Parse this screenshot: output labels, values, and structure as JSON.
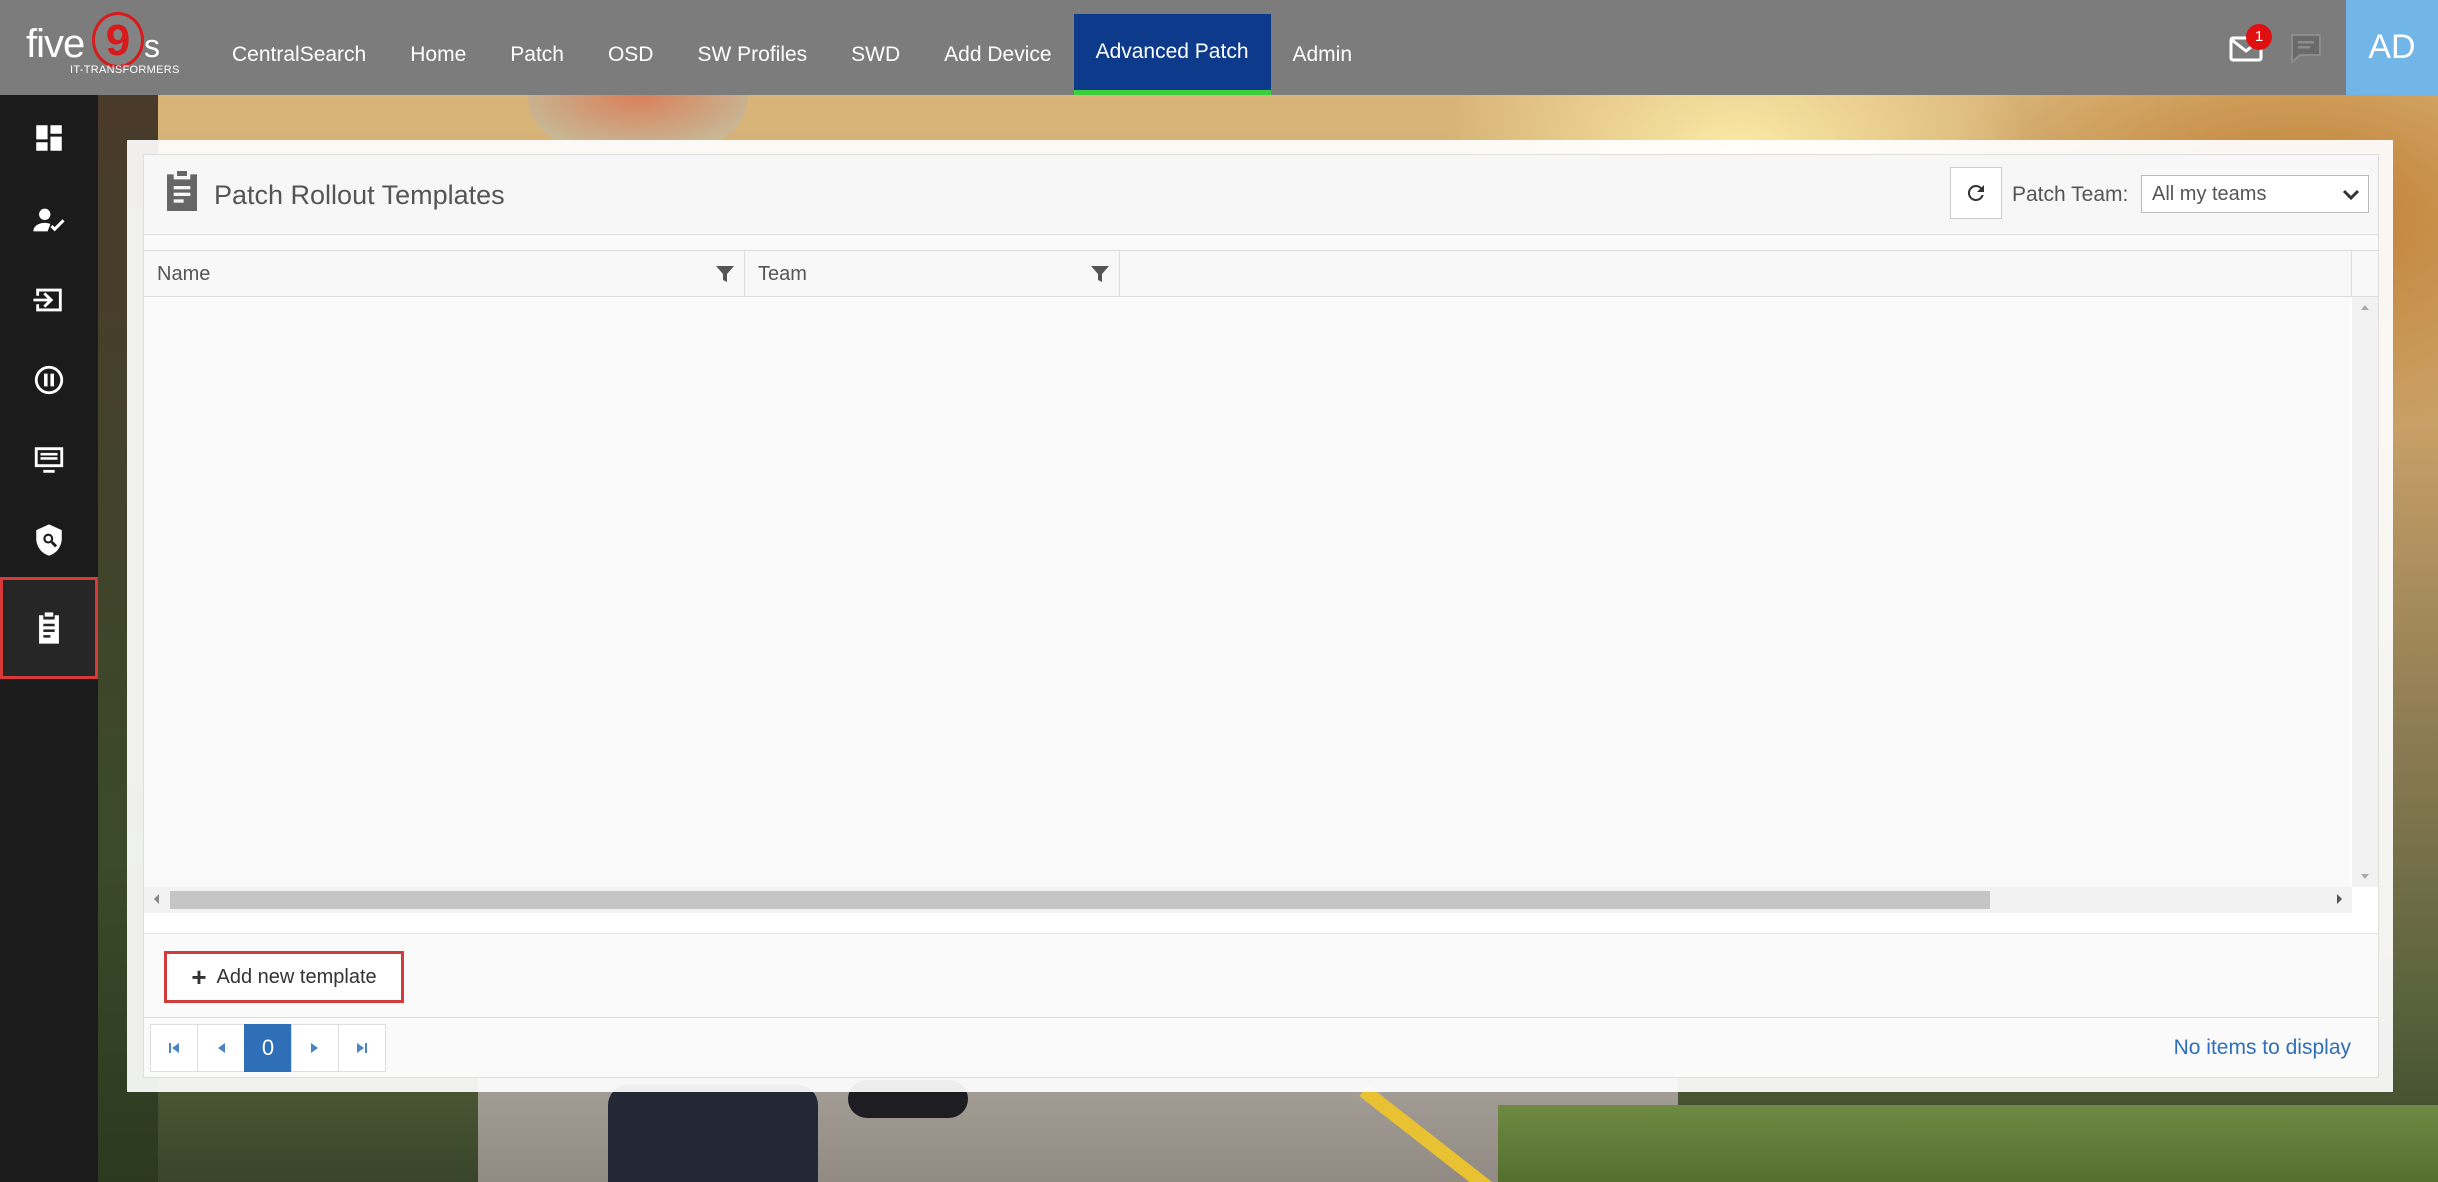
{
  "brand": {
    "logo_five": "five",
    "logo_nine": "9",
    "logo_s": "s",
    "logo_tagline": "IT-TRANSFORMERS"
  },
  "nav": {
    "items": [
      {
        "label": "CentralSearch"
      },
      {
        "label": "Home"
      },
      {
        "label": "Patch"
      },
      {
        "label": "OSD"
      },
      {
        "label": "SW Profiles"
      },
      {
        "label": "SWD"
      },
      {
        "label": "Add Device"
      },
      {
        "label": "Advanced Patch",
        "active": true
      },
      {
        "label": "Admin"
      }
    ],
    "active_color": "#0e3a8c",
    "active_underline": "#3ecf3e"
  },
  "topbar_right": {
    "mail_icon": "mail-icon",
    "mail_badge": "1",
    "chat_icon": "chat-icon",
    "avatar_initials": "AD",
    "avatar_color": "#72b6e8"
  },
  "sidebar": {
    "items": [
      {
        "icon": "dashboard-icon"
      },
      {
        "icon": "user-check-icon"
      },
      {
        "icon": "sign-in-icon"
      },
      {
        "icon": "pause-circle-icon"
      },
      {
        "icon": "monitor-list-icon"
      },
      {
        "icon": "shield-search-icon"
      },
      {
        "icon": "clipboard-icon",
        "active": true
      }
    ]
  },
  "header": {
    "title": "Patch Rollout Templates",
    "icon": "clipboard-icon",
    "refresh_icon": "refresh-icon",
    "team_label": "Patch Team:",
    "team_selected": "All my teams"
  },
  "grid": {
    "columns": [
      {
        "label": "Name"
      },
      {
        "label": "Team"
      }
    ],
    "rows": []
  },
  "toolbar": {
    "add_label": "Add new template"
  },
  "pager": {
    "current_page": "0",
    "info": "No items to display"
  }
}
